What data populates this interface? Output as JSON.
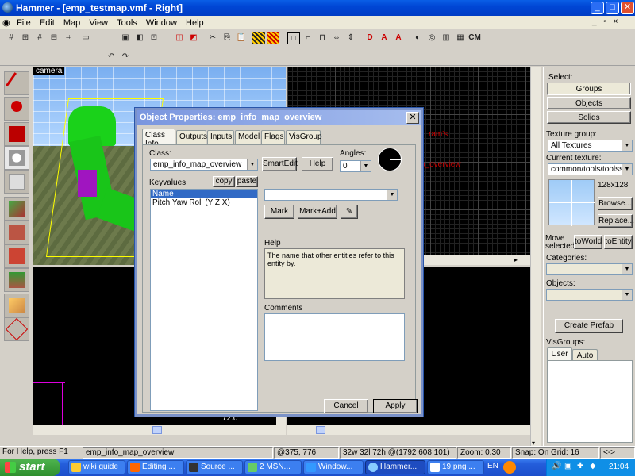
{
  "window": {
    "title": "Hammer - [emp_testmap.vmf - Right]",
    "minimize": "_",
    "maximize": "□",
    "close": "✕"
  },
  "menu": [
    "File",
    "Edit",
    "Map",
    "View",
    "Tools",
    "Window",
    "Help"
  ],
  "menu_right": {
    "min": "_",
    "restore": "▫",
    "close": "×"
  },
  "toolbar": {
    "cm_label": "CM"
  },
  "viewports": {
    "camera_label": "camera",
    "top_right_texts": [
      "ram's",
      "p_overview"
    ],
    "bottom_left_readout": "72.0"
  },
  "right_panel": {
    "select_label": "Select:",
    "groups": "Groups",
    "objects": "Objects",
    "solids": "Solids",
    "texture_group_label": "Texture group:",
    "texture_group_value": "All Textures",
    "current_texture_label": "Current texture:",
    "current_texture_value": "common/tools/toolssky",
    "texture_size": "128x128",
    "browse": "Browse...",
    "replace": "Replace...",
    "move_selected": "Move selected:",
    "to_world": "toWorld",
    "to_entity": "toEntity",
    "categories_label": "Categories:",
    "objects_label": "Objects:",
    "create_prefab": "Create Prefab",
    "visgroups_label": "VisGroups:",
    "visgroup_tabs": [
      "User",
      "Auto"
    ]
  },
  "dialog": {
    "title": "Object Properties: emp_info_map_overview",
    "close": "✕",
    "tabs": [
      "Class Info",
      "Outputs",
      "Inputs",
      "Model",
      "Flags",
      "VisGroup"
    ],
    "class_label": "Class:",
    "class_value": "emp_info_map_overview",
    "smartedit": "SmartEdit",
    "help_button": "Help",
    "angles_label": "Angles:",
    "angles_value": "0",
    "keyvalues_label": "Keyvalues:",
    "copy": "copy",
    "paste": "paste",
    "keyvalues": [
      "Name",
      "Pitch Yaw Roll (Y Z X)"
    ],
    "mark": "Mark",
    "mark_add": "Mark+Add",
    "help_label": "Help",
    "help_text": "The name that other entities refer to this entity by.",
    "comments_label": "Comments",
    "cancel": "Cancel",
    "apply": "Apply"
  },
  "statusbar": {
    "help": "For Help, press F1",
    "entity": "emp_info_map_overview",
    "coords": "@375, 776",
    "size": "32w 32l 72h @(1792 608 101)",
    "zoom": "Zoom: 0.30",
    "snap": "Snap: On Grid: 16",
    "arrows": "<->"
  },
  "taskbar": {
    "start": "start",
    "items": [
      "wiki guide",
      "Editing ...",
      "Source ...",
      "2 MSN...",
      "Window...",
      "Hammer...",
      "19.png ..."
    ],
    "active_index": 5,
    "lang": "EN",
    "clock": "21:04"
  }
}
